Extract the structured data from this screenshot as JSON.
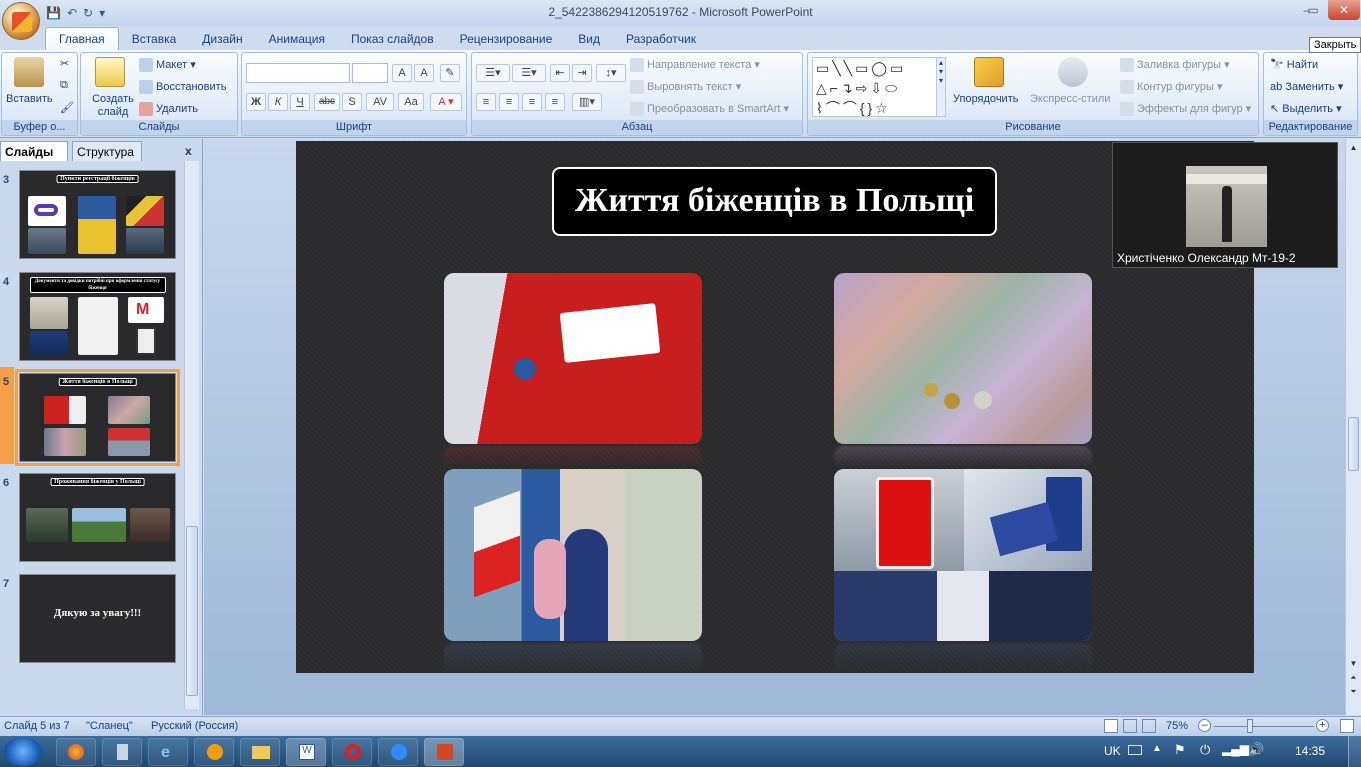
{
  "window": {
    "title": "2_5422386294120519762 - Microsoft PowerPoint",
    "close_tooltip": "Закрыть"
  },
  "tabs": [
    "Главная",
    "Вставка",
    "Дизайн",
    "Анимация",
    "Показ слайдов",
    "Рецензирование",
    "Вид",
    "Разработчик"
  ],
  "active_tab": "Главная",
  "ribbon": {
    "clipboard": {
      "paste": "Вставить",
      "label": "Буфер о..."
    },
    "slides": {
      "new_slide": "Создать слайд",
      "layout": "Макет",
      "reset": "Восстановить",
      "delete": "Удалить",
      "label": "Слайды"
    },
    "font": {
      "label": "Шрифт",
      "bold": "Ж",
      "italic": "К",
      "underline": "Ч",
      "strike": "abc",
      "shadow": "S",
      "spacing": "AV",
      "case": "Aa"
    },
    "paragraph": {
      "text_direction": "Направление текста",
      "align_text": "Выровнять текст",
      "smartart": "Преобразовать в SmartArt",
      "label": "Абзац"
    },
    "drawing": {
      "arrange": "Упорядочить",
      "quick_styles": "Экспресс-стили",
      "fill": "Заливка фигуры",
      "outline": "Контур фигуры",
      "effects": "Эффекты для фигур",
      "label": "Рисование"
    },
    "editing": {
      "find": "Найти",
      "replace": "Заменить",
      "select": "Выделить",
      "label": "Редактирование"
    }
  },
  "panel": {
    "tab_slides": "Слайды",
    "tab_outline": "Структура",
    "close": "x"
  },
  "thumbnails": [
    {
      "num": "3",
      "title": "Пункти реєстрації біженців"
    },
    {
      "num": "4",
      "title": "Документи та довідки потрібні при оформленні статусу біженця"
    },
    {
      "num": "5",
      "title": "Життя біженців в Польщі"
    },
    {
      "num": "6",
      "title": "Проживання біженців у Польщі"
    },
    {
      "num": "7",
      "title": "Дякую за увагу!!!"
    }
  ],
  "slide": {
    "title": "Життя біженців  в  Польщі"
  },
  "video": {
    "participant_name": "Христіченко Олександр Мт-19-2"
  },
  "status": {
    "slide_info": "Слайд 5 из 7",
    "theme": "\"Сланец\"",
    "language": "Русский (Россия)",
    "zoom": "75%"
  },
  "taskbar": {
    "lang": "UK",
    "time": "14:35"
  }
}
